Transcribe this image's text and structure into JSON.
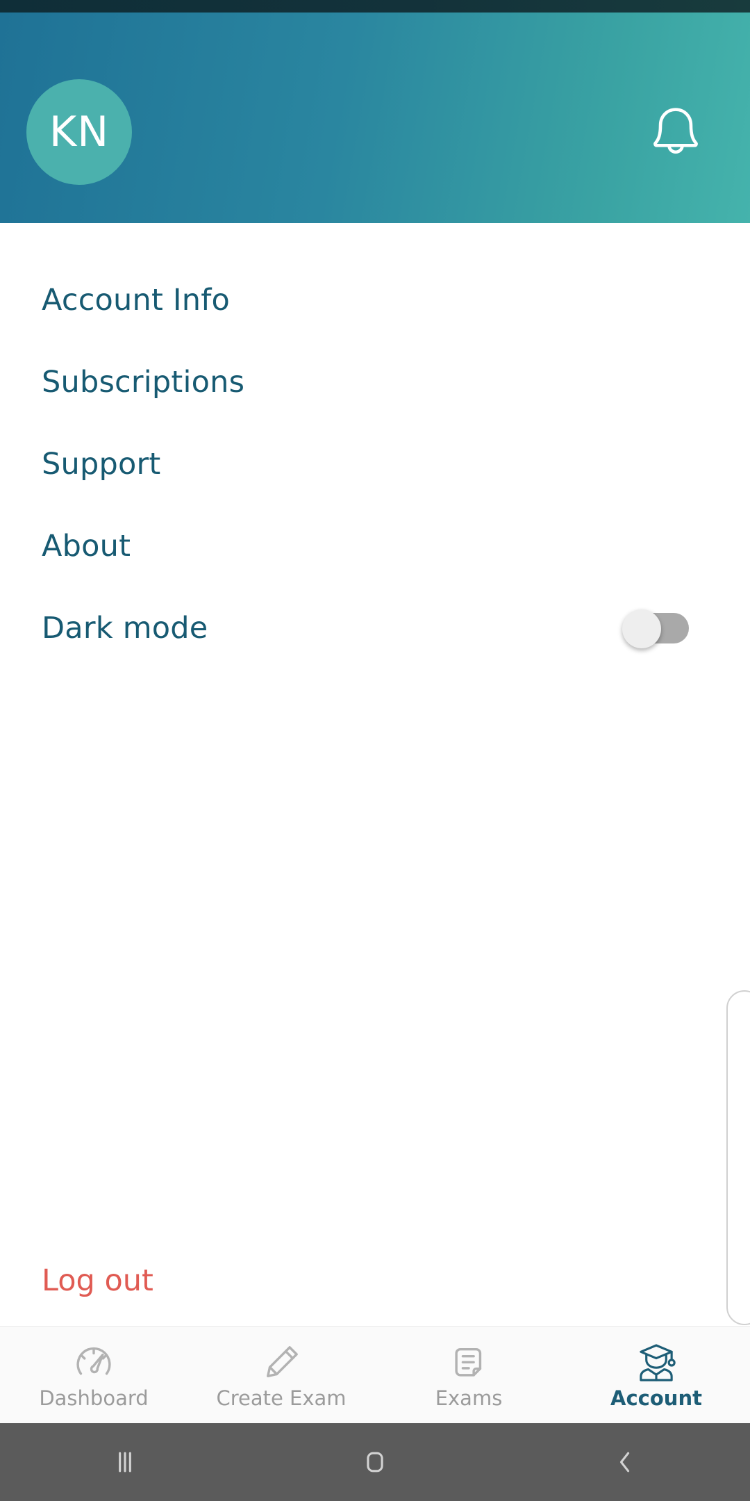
{
  "header": {
    "avatar_initials": "KN",
    "avatar_name": "avatar",
    "bell_icon": "bell-icon",
    "gradient_start": "#1f7296",
    "gradient_end": "#45b3ac",
    "avatar_color": "#4bb1ad"
  },
  "menu": {
    "items": [
      {
        "label": "Account Info",
        "name": "account-info"
      },
      {
        "label": "Subscriptions",
        "name": "subscriptions"
      },
      {
        "label": "Support",
        "name": "support"
      },
      {
        "label": "About",
        "name": "about"
      },
      {
        "label": "Dark mode",
        "name": "dark-mode"
      }
    ],
    "dark_mode_toggle": {
      "state": "off",
      "track_color": "#a9a9a9",
      "thumb_color": "#eeeeee"
    },
    "text_color": "#175a72"
  },
  "logout": {
    "label": "Log out",
    "color": "#e05b53"
  },
  "tabs": [
    {
      "label": "Dashboard",
      "icon": "speedometer-icon",
      "active": false
    },
    {
      "label": "Create Exam",
      "icon": "pencil-icon",
      "active": false
    },
    {
      "label": "Exams",
      "icon": "documents-icon",
      "active": false
    },
    {
      "label": "Account",
      "icon": "graduate-icon",
      "active": true
    }
  ],
  "tab_colors": {
    "inactive": "#9b9b9b",
    "active": "#1d5d76"
  },
  "system_nav": {
    "recents_label": "recents",
    "home_label": "home",
    "back_label": "back",
    "background": "#5b5b5b"
  }
}
